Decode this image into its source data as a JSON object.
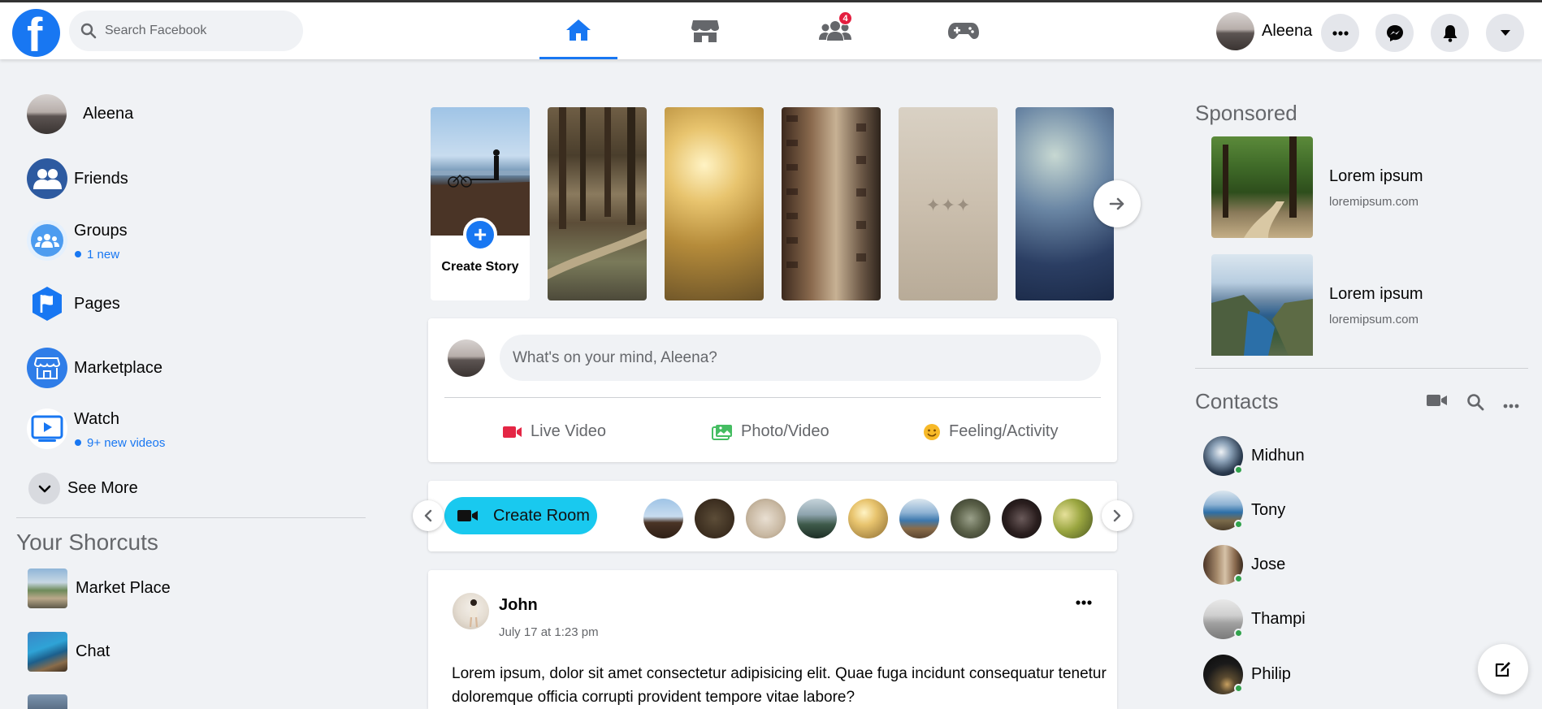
{
  "header": {
    "search_placeholder": "Search Facebook",
    "nav_tabs": [
      {
        "name": "home",
        "icon": "home-icon",
        "active": true
      },
      {
        "name": "marketplace",
        "icon": "store-icon",
        "active": false
      },
      {
        "name": "groups",
        "icon": "groups-icon",
        "badge": "4",
        "active": false
      },
      {
        "name": "gaming",
        "icon": "gamepad-icon",
        "active": false
      }
    ],
    "profile_name": "Aleena",
    "right_buttons": [
      "more-icon",
      "messenger-icon",
      "bell-icon",
      "caret-down-icon"
    ],
    "accent_color": "#1877f2"
  },
  "sidebar": {
    "profile_name": "Aleena",
    "items": [
      {
        "label": "Friends",
        "icon": "friends-icon"
      },
      {
        "label": "Groups",
        "icon": "groups-icon",
        "sub": "1 new"
      },
      {
        "label": "Pages",
        "icon": "flag-icon"
      },
      {
        "label": "Marketplace",
        "icon": "store-icon"
      },
      {
        "label": "Watch",
        "icon": "watch-icon",
        "sub": "9+ new videos"
      }
    ],
    "see_more": "See More",
    "shortcuts_title": "Your Shorcuts",
    "shortcuts": [
      {
        "label": "Market Place"
      },
      {
        "label": "Chat"
      }
    ]
  },
  "stories": {
    "create_label": "Create Story"
  },
  "composer": {
    "placeholder": "What's on your mind, Aleena?",
    "actions": [
      {
        "label": "Live Video",
        "icon": "live-video-icon",
        "color": "#e42645"
      },
      {
        "label": "Photo/Video",
        "icon": "photo-icon",
        "color": "#45bd62"
      },
      {
        "label": "Feeling/Activity",
        "icon": "smiley-icon",
        "color": "#f7b928"
      }
    ]
  },
  "rooms": {
    "create_label": "Create Room"
  },
  "post": {
    "author": "John",
    "time": "July 17 at 1:23 pm",
    "text": "Lorem ipsum, dolor sit amet consectetur adipisicing elit. Quae fuga incidunt consequatur tenetur doloremque officia corrupti provident tempore vitae labore?"
  },
  "sponsored": {
    "title": "Sponsored",
    "ads": [
      {
        "title": "Lorem ipsum",
        "url": "loremipsum.com"
      },
      {
        "title": "Lorem ipsum",
        "url": "loremipsum.com"
      }
    ]
  },
  "contacts": {
    "title": "Contacts",
    "people": [
      "Midhun",
      "Tony",
      "Jose",
      "Thampi",
      "Philip"
    ]
  }
}
